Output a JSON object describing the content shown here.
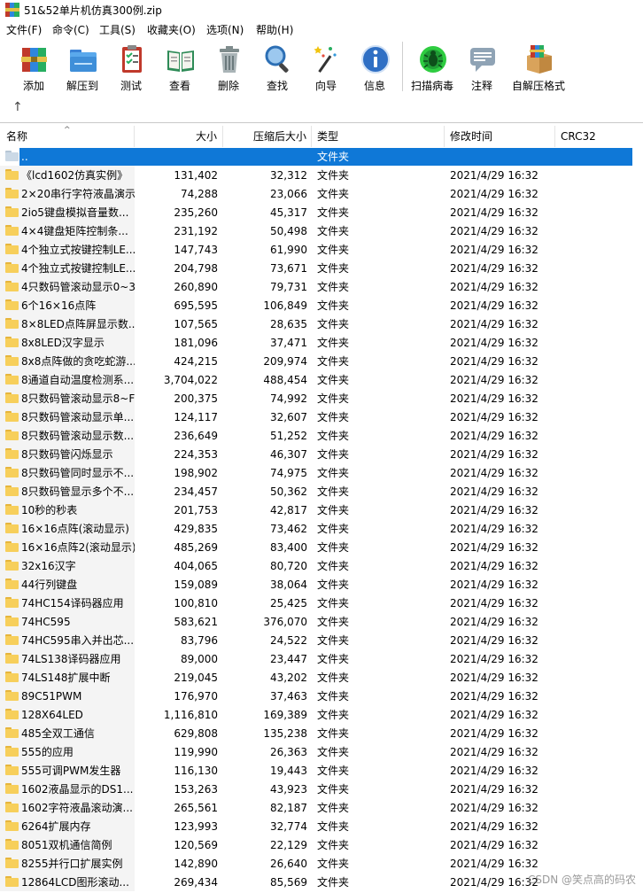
{
  "window": {
    "title": "51&52单片机仿真300例.zip"
  },
  "menu": [
    "文件(F)",
    "命令(C)",
    "工具(S)",
    "收藏夹(O)",
    "选项(N)",
    "帮助(H)"
  ],
  "toolbar": {
    "buttons": [
      {
        "label": "添加",
        "icon": "add-books-icon"
      },
      {
        "label": "解压到",
        "icon": "extract-folder-icon"
      },
      {
        "label": "测试",
        "icon": "test-clipboard-icon"
      },
      {
        "label": "查看",
        "icon": "view-book-icon"
      },
      {
        "label": "删除",
        "icon": "delete-trash-icon"
      },
      {
        "label": "查找",
        "icon": "find-magnifier-icon"
      },
      {
        "label": "向导",
        "icon": "wizard-wand-icon"
      },
      {
        "label": "信息",
        "icon": "info-icon"
      },
      {
        "label": "扫描病毒",
        "icon": "virus-scan-icon"
      },
      {
        "label": "注释",
        "icon": "comment-icon"
      },
      {
        "label": "自解压格式",
        "icon": "sfx-box-icon"
      }
    ]
  },
  "nav": {
    "up_glyph": "↑"
  },
  "columns": {
    "name": "名称",
    "size": "大小",
    "packed": "压缩后大小",
    "type": "类型",
    "modified": "修改时间",
    "crc": "CRC32"
  },
  "parent_row": {
    "name": "..",
    "type": "文件夹"
  },
  "rows": [
    {
      "name": "《lcd1602仿真实例》",
      "size": "131,402",
      "packed": "32,312",
      "type": "文件夹",
      "modified": "2021/4/29 16:32"
    },
    {
      "name": "2×20串行字符液晶演示",
      "size": "74,288",
      "packed": "23,066",
      "type": "文件夹",
      "modified": "2021/4/29 16:32"
    },
    {
      "name": "2io5键盘模拟音量数...",
      "size": "235,260",
      "packed": "45,317",
      "type": "文件夹",
      "modified": "2021/4/29 16:32"
    },
    {
      "name": "4×4键盘矩阵控制条...",
      "size": "231,192",
      "packed": "50,498",
      "type": "文件夹",
      "modified": "2021/4/29 16:32"
    },
    {
      "name": "4个独立式按键控制LE...",
      "size": "147,743",
      "packed": "61,990",
      "type": "文件夹",
      "modified": "2021/4/29 16:32"
    },
    {
      "name": "4个独立式按键控制LE...",
      "size": "204,798",
      "packed": "73,671",
      "type": "文件夹",
      "modified": "2021/4/29 16:32"
    },
    {
      "name": "4只数码管滚动显示0~3",
      "size": "260,890",
      "packed": "79,731",
      "type": "文件夹",
      "modified": "2021/4/29 16:32"
    },
    {
      "name": "6个16×16点阵",
      "size": "695,595",
      "packed": "106,849",
      "type": "文件夹",
      "modified": "2021/4/29 16:32"
    },
    {
      "name": "8×8LED点阵屏显示数...",
      "size": "107,565",
      "packed": "28,635",
      "type": "文件夹",
      "modified": "2021/4/29 16:32"
    },
    {
      "name": "8x8LED汉字显示",
      "size": "181,096",
      "packed": "37,471",
      "type": "文件夹",
      "modified": "2021/4/29 16:32"
    },
    {
      "name": "8x8点阵做的贪吃蛇游...",
      "size": "424,215",
      "packed": "209,974",
      "type": "文件夹",
      "modified": "2021/4/29 16:32"
    },
    {
      "name": "8通道自动温度检测系...",
      "size": "3,704,022",
      "packed": "488,454",
      "type": "文件夹",
      "modified": "2021/4/29 16:32"
    },
    {
      "name": "8只数码管滚动显示8~F",
      "size": "200,375",
      "packed": "74,992",
      "type": "文件夹",
      "modified": "2021/4/29 16:32"
    },
    {
      "name": "8只数码管滚动显示单...",
      "size": "124,117",
      "packed": "32,607",
      "type": "文件夹",
      "modified": "2021/4/29 16:32"
    },
    {
      "name": "8只数码管滚动显示数...",
      "size": "236,649",
      "packed": "51,252",
      "type": "文件夹",
      "modified": "2021/4/29 16:32"
    },
    {
      "name": "8只数码管闪烁显示",
      "size": "224,353",
      "packed": "46,307",
      "type": "文件夹",
      "modified": "2021/4/29 16:32"
    },
    {
      "name": "8只数码管同时显示不...",
      "size": "198,902",
      "packed": "74,975",
      "type": "文件夹",
      "modified": "2021/4/29 16:32"
    },
    {
      "name": "8只数码管显示多个不...",
      "size": "234,457",
      "packed": "50,362",
      "type": "文件夹",
      "modified": "2021/4/29 16:32"
    },
    {
      "name": "10秒的秒表",
      "size": "201,753",
      "packed": "42,817",
      "type": "文件夹",
      "modified": "2021/4/29 16:32"
    },
    {
      "name": "16×16点阵(滚动显示)",
      "size": "429,835",
      "packed": "73,462",
      "type": "文件夹",
      "modified": "2021/4/29 16:32"
    },
    {
      "name": "16×16点阵2(滚动显示)",
      "size": "485,269",
      "packed": "83,400",
      "type": "文件夹",
      "modified": "2021/4/29 16:32"
    },
    {
      "name": "32x16汉字",
      "size": "404,065",
      "packed": "80,720",
      "type": "文件夹",
      "modified": "2021/4/29 16:32"
    },
    {
      "name": "44行列键盘",
      "size": "159,089",
      "packed": "38,064",
      "type": "文件夹",
      "modified": "2021/4/29 16:32"
    },
    {
      "name": "74HC154译码器应用",
      "size": "100,810",
      "packed": "25,425",
      "type": "文件夹",
      "modified": "2021/4/29 16:32"
    },
    {
      "name": "74HC595",
      "size": "583,621",
      "packed": "376,070",
      "type": "文件夹",
      "modified": "2021/4/29 16:32"
    },
    {
      "name": "74HC595串入并出芯...",
      "size": "83,796",
      "packed": "24,522",
      "type": "文件夹",
      "modified": "2021/4/29 16:32"
    },
    {
      "name": "74LS138译码器应用",
      "size": "89,000",
      "packed": "23,447",
      "type": "文件夹",
      "modified": "2021/4/29 16:32"
    },
    {
      "name": "74LS148扩展中断",
      "size": "219,045",
      "packed": "43,202",
      "type": "文件夹",
      "modified": "2021/4/29 16:32"
    },
    {
      "name": "89C51PWM",
      "size": "176,970",
      "packed": "37,463",
      "type": "文件夹",
      "modified": "2021/4/29 16:32"
    },
    {
      "name": "128X64LED",
      "size": "1,116,810",
      "packed": "169,389",
      "type": "文件夹",
      "modified": "2021/4/29 16:32"
    },
    {
      "name": "485全双工通信",
      "size": "629,808",
      "packed": "135,238",
      "type": "文件夹",
      "modified": "2021/4/29 16:32"
    },
    {
      "name": "555的应用",
      "size": "119,990",
      "packed": "26,363",
      "type": "文件夹",
      "modified": "2021/4/29 16:32"
    },
    {
      "name": "555可调PWM发生器",
      "size": "116,130",
      "packed": "19,443",
      "type": "文件夹",
      "modified": "2021/4/29 16:32"
    },
    {
      "name": "1602液晶显示的DS1...",
      "size": "153,263",
      "packed": "43,923",
      "type": "文件夹",
      "modified": "2021/4/29 16:32"
    },
    {
      "name": "1602字符液晶滚动演...",
      "size": "265,561",
      "packed": "82,187",
      "type": "文件夹",
      "modified": "2021/4/29 16:32"
    },
    {
      "name": "6264扩展内存",
      "size": "123,993",
      "packed": "32,774",
      "type": "文件夹",
      "modified": "2021/4/29 16:32"
    },
    {
      "name": "8051双机通信简例",
      "size": "120,569",
      "packed": "22,129",
      "type": "文件夹",
      "modified": "2021/4/29 16:32"
    },
    {
      "name": "8255并行口扩展实例",
      "size": "142,890",
      "packed": "26,640",
      "type": "文件夹",
      "modified": "2021/4/29 16:32"
    },
    {
      "name": "12864LCD图形滚动...",
      "size": "269,434",
      "packed": "85,569",
      "type": "文件夹",
      "modified": "2021/4/29 16:32"
    }
  ],
  "watermark": "CSDN @笑点高的码农"
}
